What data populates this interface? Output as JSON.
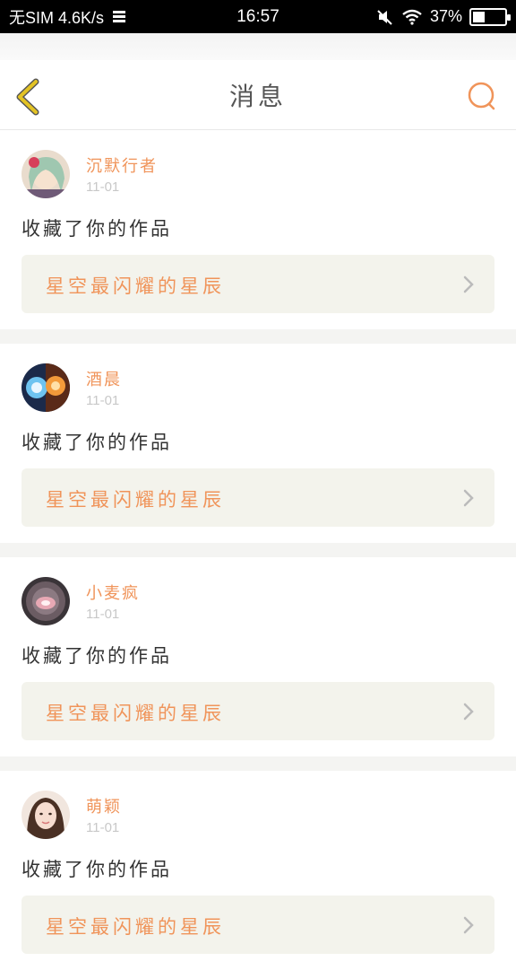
{
  "status_bar": {
    "carrier": "无SIM 4.6K/s",
    "time": "16:57",
    "battery_text": "37%",
    "battery_level": 0.37
  },
  "header": {
    "title": "消息",
    "back_icon": "chevron-left-icon",
    "search_icon": "search-icon"
  },
  "colors": {
    "accent": "#f0945a",
    "back_icon": "#d9b91c",
    "card_link_bg": "#f3f3ec"
  },
  "messages": [
    {
      "user": "沉默行者",
      "date": "11-01",
      "action": "收藏了你的作品",
      "work_title": "星空最闪耀的星辰"
    },
    {
      "user": "酒晨",
      "date": "11-01",
      "action": "收藏了你的作品",
      "work_title": "星空最闪耀的星辰"
    },
    {
      "user": "小麦疯",
      "date": "11-01",
      "action": "收藏了你的作品",
      "work_title": "星空最闪耀的星辰"
    },
    {
      "user": "萌颖",
      "date": "11-01",
      "action": "收藏了你的作品",
      "work_title": "星空最闪耀的星辰"
    }
  ]
}
